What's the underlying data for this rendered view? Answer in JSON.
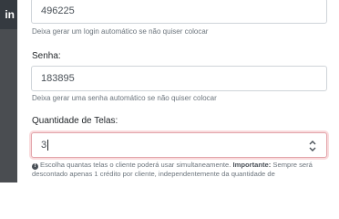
{
  "background": {
    "login_label": "in"
  },
  "form": {
    "login": {
      "value": "496225",
      "help": "Deixa gerar um login automático se não quiser colocar"
    },
    "senha": {
      "label": "Senha:",
      "value": "183895",
      "help": "Deixa gerar uma senha automático se não quiser colocar"
    },
    "quantidade": {
      "label": "Quantidade de Telas:",
      "value": "3",
      "help_text": "Escolha quantas telas o cliente poderá usar simultaneamente.",
      "help_bold": "Importante:",
      "help_rest": "Sempre será descontado apenas 1 crédito por cliente, independentemente da quantidade de"
    }
  },
  "colors": {
    "invalid_border": "#e3a4aa",
    "backdrop": "#4a4d51"
  },
  "icons": {
    "info": "info-circle-icon",
    "spinner_up": "chevron-up-icon",
    "spinner_down": "chevron-down-icon"
  }
}
